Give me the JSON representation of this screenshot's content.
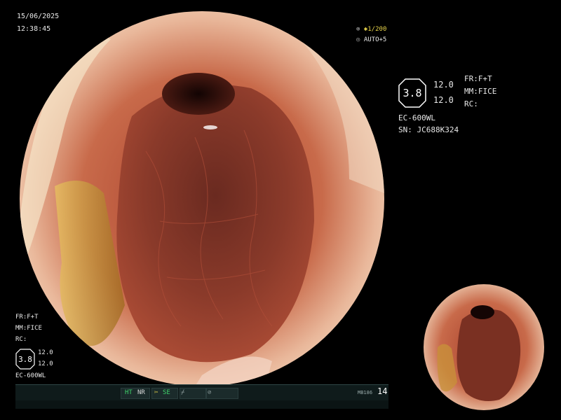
{
  "datetime": {
    "date": "15/06/2025",
    "time": "12:38:45"
  },
  "exposure": {
    "shutter": "1/200",
    "auto": "AUTO+5"
  },
  "scope_panel": {
    "badge_value": "3.8",
    "value_top": "12.0",
    "value_bottom": "12.0",
    "fr": "FR:F+T",
    "mm": "MM:FICE",
    "rc": "RC:",
    "model": "EC-600WL",
    "serial": "SN: JC688K324"
  },
  "corner_panel": {
    "fr": "FR:F+T",
    "mm": "MM:FICE",
    "rc": "RC:",
    "badge_value": "3.8",
    "value_top": "12.0",
    "value_bottom": "12.0",
    "model": "EC-600WL"
  },
  "status_bar": {
    "ht": "HT",
    "nr": "NR",
    "se": "SE",
    "code": "MB186",
    "number": "14"
  },
  "colors": {
    "status_green": "#3fd26a",
    "status_yellow": "#e8d44a",
    "bar_bg": "#0f1b1b"
  }
}
